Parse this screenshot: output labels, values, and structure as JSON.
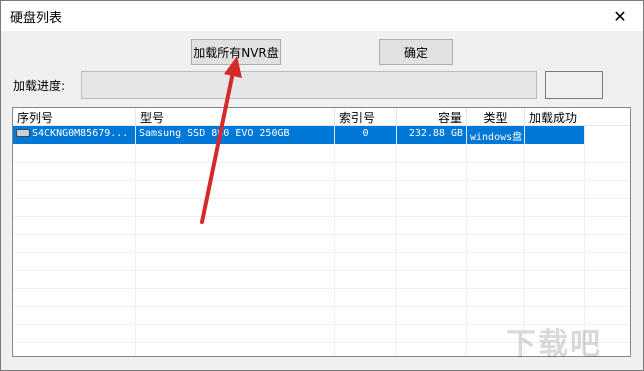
{
  "window": {
    "title": "硬盘列表",
    "close_glyph": "✕"
  },
  "buttons": {
    "load_all": "加载所有NVR盘",
    "ok": "确定"
  },
  "progress": {
    "label": "加载进度:",
    "value": 0
  },
  "table": {
    "columns": [
      "序列号",
      "型号",
      "索引号",
      "容量",
      "类型",
      "加载成功"
    ],
    "rows": [
      {
        "serial": "S4CKNG0M85679...",
        "model": "Samsung SSD 860 EVO 250GB",
        "index": "0",
        "capacity": "232.88 GB",
        "type": "windows盘",
        "loaded": ""
      }
    ]
  },
  "watermark": {
    "text": "下载吧"
  },
  "colors": {
    "selection": "#0078d7",
    "annotation_arrow": "#d42a2a"
  }
}
